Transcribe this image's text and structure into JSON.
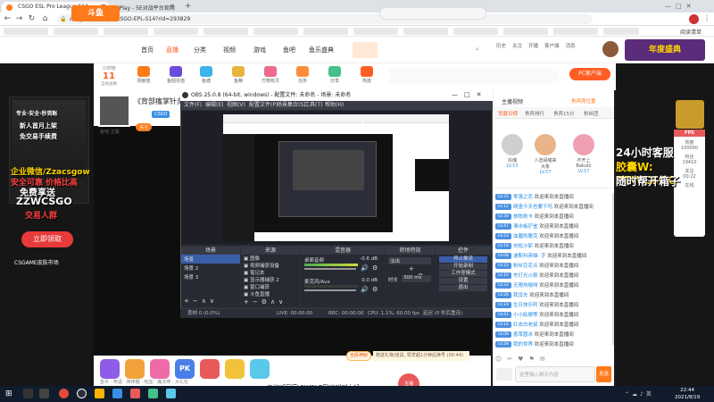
{
  "browser": {
    "tabs": [
      {
        "label": "CSGO ESL Pro League S14",
        "active": true,
        "color": "#ff7a1a"
      },
      {
        "label": "5EPlay - 5E对战平台官网",
        "active": false,
        "color": "#e34b3b"
      }
    ],
    "new_tab": "+",
    "url": "douyu.com/topic/CSGO-EPL-S14?rid=293829",
    "bookmark_last": "阅读清单"
  },
  "site": {
    "logo": "斗鱼",
    "nav": [
      "首页",
      "直播",
      "分类",
      "视频",
      "游戏",
      "鱼吧",
      "鱼乐盛典"
    ],
    "header_right": [
      "历史",
      "关注",
      "开播",
      "客户端",
      "消息",
      "个人中心"
    ],
    "promo_right": "年度盛典"
  },
  "room": {
    "rank_label": "小时榜",
    "rank_value": "11",
    "rank_sub": "全站总榜",
    "gifts": [
      "贡献值",
      "鱼翅充值",
      "鱼塘",
      "鱼粮",
      "万物有灵",
      "任务",
      "分享",
      "热度"
    ],
    "rank_button": "PC客户端",
    "title": "《背部瘙掌针灸》",
    "anchor_name": "鱼吧·主播",
    "follow": "关注",
    "badge": "CSGO"
  },
  "left_promo": {
    "top1": "专业·安全·秒到账",
    "top2": "新人首月上架",
    "top3": "免交易手续费",
    "wechat1": "企业微信/Zzacsgow",
    "wechat2": "安全可靠 价格比高",
    "free": "免费享送",
    "wechat3": "ZZWCSGO",
    "group": "交易人群",
    "cta": "立即领取",
    "market": "CSGAME皮肤市场"
  },
  "obs": {
    "title": "OBS 25.0.8 (64-bit, windows) - 配置文件: 未命名 - 场景: 未命名",
    "menus": [
      "文件(F)",
      "编辑(E)",
      "视图(V)",
      "配置文件(P)",
      "场景集合(S)",
      "工具(T)",
      "帮助(H)"
    ],
    "docks": [
      "场景",
      "来源",
      "混音器",
      "转场特效",
      "控件"
    ],
    "scenes": [
      "场景",
      "场景 2",
      "场景 3"
    ],
    "sources": [
      "图像",
      "视频捕获设备",
      "笔记本",
      "显示器捕获 2",
      "窗口捕获",
      "斗鱼直播"
    ],
    "mixer": [
      {
        "name": "桌面音频",
        "db": "-0.6 dB"
      },
      {
        "name": "麦克风/Aux",
        "db": "0.0 dB"
      }
    ],
    "transition": "淡出",
    "duration_label": "时长",
    "duration": "300 ms",
    "controls": [
      "停止推流",
      "开始录制",
      "工作室模式",
      "设置",
      "退出"
    ],
    "status": [
      "丢帧 0 (0.0%)",
      "LIVE: 00:00:00",
      "REC: 00:00:00",
      "CPU: 1.1%, 60.00 fps"
    ],
    "status_right": "延迟 (0 秒后重连)"
  },
  "chat": {
    "header": "主播视频",
    "rank_link": "贵宾席位置",
    "tabs": [
      "贡献日榜",
      "贵宾排行",
      "贵宾15分",
      "粉丝团"
    ],
    "fans": [
      {
        "name": "抖魂",
        "lv": "LV.53"
      },
      {
        "name": "人选闹喵来大象",
        "lv": "LV.57"
      },
      {
        "name": "不开上Bakuhi",
        "lv": "LV.57"
      }
    ],
    "welcome": "欢迎来到本直播间",
    "lines": [
      {
        "lv": "LV.35",
        "name": "零落之恋"
      },
      {
        "lv": "LV.12",
        "name": "晴墨今天也要下吗"
      },
      {
        "lv": "LV.30",
        "name": "放牧刷卡"
      },
      {
        "lv": "LV.47",
        "name": "滑冰板铲雀"
      },
      {
        "lv": "LV.23",
        "name": "血腥凯撒克"
      },
      {
        "lv": "LV.18",
        "name": "刘松沙耶"
      },
      {
        "lv": "LV.08",
        "name": "迪斯科英雄· 字"
      },
      {
        "lv": "LV.22",
        "name": "粉丝豆花点"
      },
      {
        "lv": "LV.10",
        "name": "东打光火箭"
      },
      {
        "lv": "LV.33",
        "name": "无限热咖啡"
      },
      {
        "lv": "LV.26",
        "name": "我没去"
      },
      {
        "lv": "LV.19",
        "name": "生日快乐阿"
      },
      {
        "lv": "LV.41",
        "name": "小小姑娘等"
      },
      {
        "lv": "LV.14",
        "name": "红衣白老鼠"
      },
      {
        "lv": "LV.09",
        "name": "香草圆冰"
      },
      {
        "lv": "LV.28",
        "name": "我的世界"
      },
      {
        "lv": "LV.16",
        "name": "聚在人不"
      }
    ],
    "input_placeholder": "这里输入聊天内容",
    "send": "发送"
  },
  "right_overlay": {
    "line1": "24小时客服",
    "line2": "胶囊W: ZZWCSGO",
    "line3": "随时帮开箱子",
    "fps": "FPS",
    "fps_items": [
      "热度",
      "100000",
      "粉丝",
      "19410",
      "关注",
      "00:22",
      "在线"
    ]
  },
  "giftbar": {
    "items": [
      "金币",
      "啤酒",
      "棒棒糖",
      "PK",
      "吸血",
      "魔法棒",
      "大礼包"
    ],
    "notice": "赠送礼物/道具, 赞赏超1分钟后换号 (00:44)",
    "live_btn": "全民神射",
    "gift_btn": "主播"
  },
  "subtitle": "中路听回家 SIMPLE回数短短上场",
  "taskbar": {
    "time": "22:44",
    "date": "2021/8/19"
  }
}
